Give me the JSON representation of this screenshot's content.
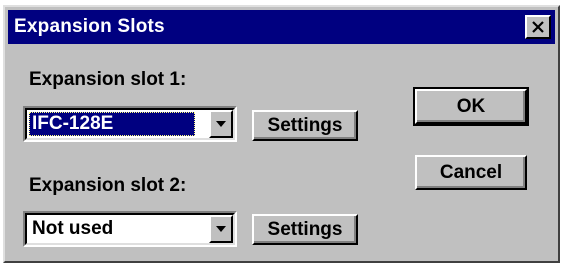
{
  "window": {
    "title": "Expansion Slots"
  },
  "slot1": {
    "label": "Expansion slot 1:",
    "value": "IFC-128E",
    "settings_label": "Settings"
  },
  "slot2": {
    "label": "Expansion slot 2:",
    "value": "Not used",
    "settings_label": "Settings"
  },
  "buttons": {
    "ok_label": "OK",
    "cancel_label": "Cancel"
  },
  "icons": {
    "close": "close-icon",
    "dropdown": "chevron-down-icon"
  },
  "colors": {
    "titlebar": "#000080",
    "face": "#c0c0c0",
    "selection": "#000080"
  }
}
